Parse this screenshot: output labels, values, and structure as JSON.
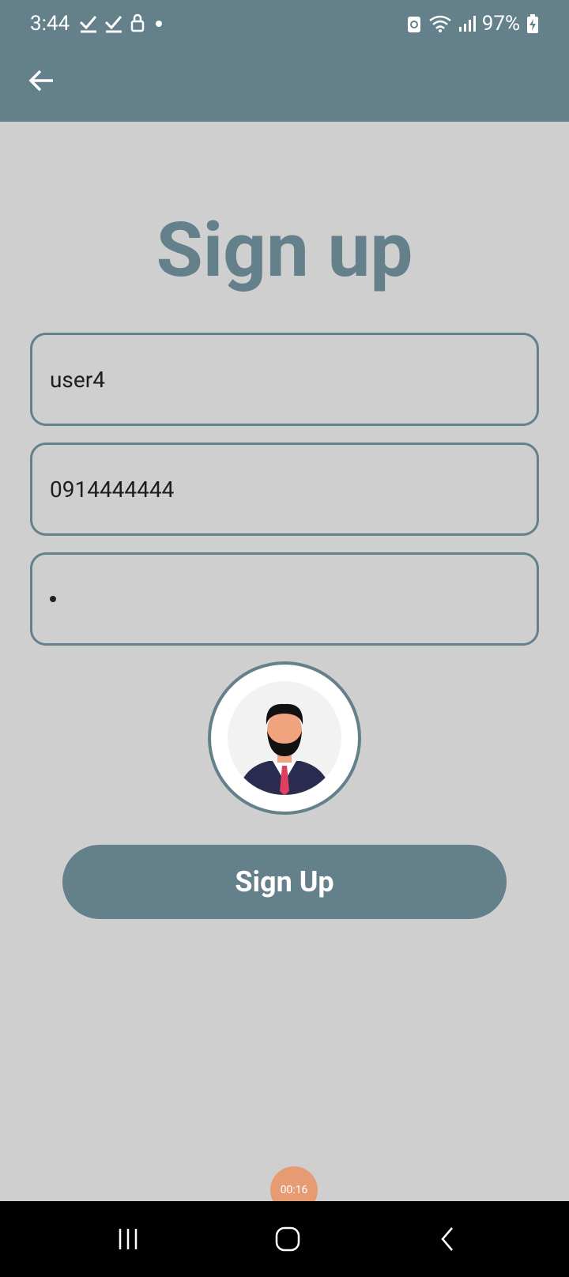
{
  "status_bar": {
    "time": "3:44",
    "battery": "97%",
    "icons": [
      "check-icon",
      "check-icon",
      "lock-icon",
      "dot-icon",
      "recycle-icon",
      "wifi-icon",
      "signal-icon",
      "battery-charging-icon"
    ]
  },
  "header": {
    "back_icon": "arrow-left-icon"
  },
  "page": {
    "title": "Sign up"
  },
  "form": {
    "username": "user4",
    "phone": "0914444444",
    "password_mask": "•"
  },
  "avatar": {
    "icon": "avatar-image"
  },
  "signup_button": {
    "label": "Sign Up"
  },
  "recording": {
    "timer": "00:16"
  },
  "nav": {
    "icons": [
      "recents-icon",
      "home-icon",
      "back-icon"
    ]
  },
  "colors": {
    "primary": "#64808a",
    "background": "#cfcfcf",
    "badge": "#e69b72"
  }
}
